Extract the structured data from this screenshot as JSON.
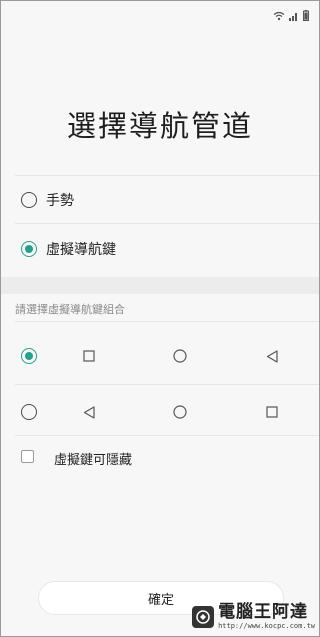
{
  "status_bar": {
    "icons": [
      "wifi-icon",
      "signal-icon",
      "battery-icon"
    ]
  },
  "page": {
    "title": "選擇導航管道"
  },
  "navigation_modes": [
    {
      "label": "手勢",
      "selected": false
    },
    {
      "label": "虛擬導航鍵",
      "selected": true
    }
  ],
  "combinations": {
    "header": "請選擇虛擬導航鍵組合",
    "rows": [
      {
        "selected": true,
        "buttons": [
          "square-icon",
          "circle-icon",
          "triangle-left-icon"
        ]
      },
      {
        "selected": false,
        "buttons": [
          "triangle-left-icon",
          "circle-icon",
          "square-icon"
        ]
      }
    ]
  },
  "hide_keys": {
    "label": "虛擬鍵可隱藏",
    "checked": false
  },
  "confirm": {
    "label": "確定"
  },
  "watermark": {
    "title": "電腦王阿達",
    "url": "http://www.kocpc.com.tw"
  },
  "colors": {
    "accent": "#2a9d8f",
    "background": "#f7f7f7",
    "section_band": "#ececec"
  }
}
